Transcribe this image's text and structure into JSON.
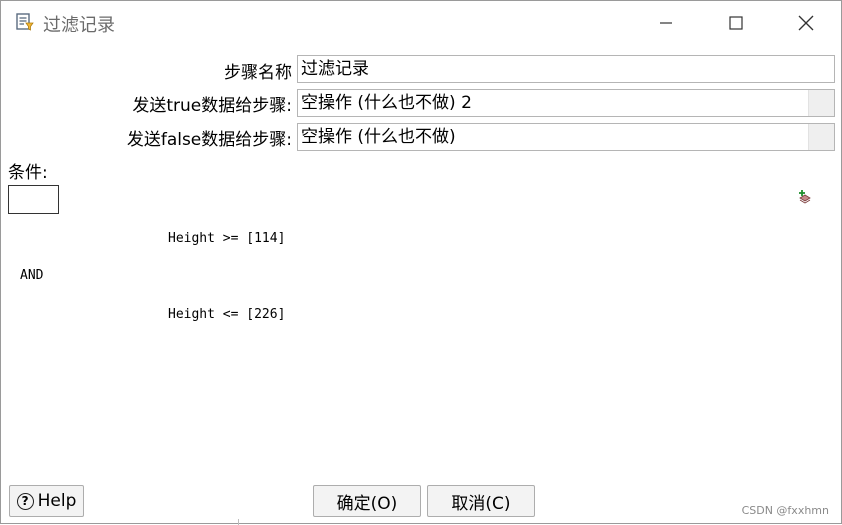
{
  "window": {
    "title": "过滤记录",
    "title_color": "#6b6b6b"
  },
  "form": {
    "step_name_label": "步骤名称",
    "step_name_value": "过滤记录",
    "true_label": "发送true数据给步骤:",
    "true_value": "空操作 (什么也不做) 2",
    "false_label": "发送false数据给步骤:",
    "false_value": "空操作 (什么也不做)"
  },
  "condition": {
    "label": "条件:",
    "line1": "Height >= [114]",
    "operator": "AND",
    "line2": "Height <= [226]"
  },
  "buttons": {
    "help": "Help",
    "ok": "确定(O)",
    "cancel": "取消(C)"
  },
  "watermark": "CSDN @fxxhmn"
}
